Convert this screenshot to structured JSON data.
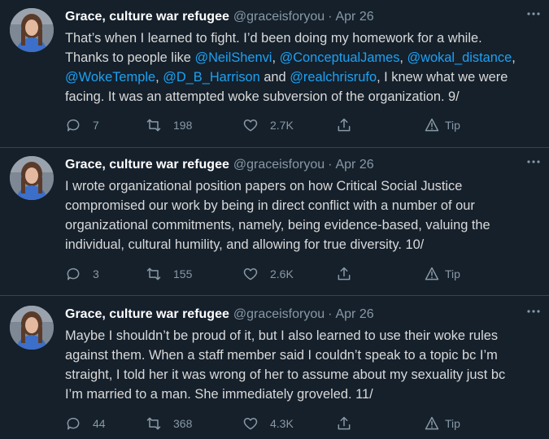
{
  "tweets": [
    {
      "display_name": "Grace, culture war refugee",
      "handle": "@graceisforyou",
      "separator": "·",
      "date": "Apr 26",
      "lines": [
        [
          {
            "t": "That’s when I learned to fight. I’d been doing my homework for a while."
          }
        ],
        [
          {
            "t": "Thanks to people like "
          },
          {
            "t": "@NeilShenvi",
            "m": true
          },
          {
            "t": ", "
          },
          {
            "t": "@ConceptualJames",
            "m": true
          },
          {
            "t": ", "
          },
          {
            "t": "@wokal_distance",
            "m": true
          },
          {
            "t": ","
          }
        ],
        [
          {
            "t": "@WokeTemple",
            "m": true
          },
          {
            "t": ", "
          },
          {
            "t": "@D_B_Harrison",
            "m": true
          },
          {
            "t": " and "
          },
          {
            "t": "@realchrisrufo",
            "m": true
          },
          {
            "t": ", I knew what we were"
          }
        ],
        [
          {
            "t": "facing. It was an attempted woke subversion of the organization. 9/"
          }
        ]
      ],
      "replies": "7",
      "retweets": "198",
      "likes": "2.7K",
      "tip_label": "Tip"
    },
    {
      "display_name": "Grace, culture war refugee",
      "handle": "@graceisforyou",
      "separator": "·",
      "date": "Apr 26",
      "lines": [
        [
          {
            "t": "I wrote organizational position papers on how Critical Social Justice"
          }
        ],
        [
          {
            "t": "compromised our work by being in direct conflict with a number of our"
          }
        ],
        [
          {
            "t": "organizational commitments, namely, being evidence-based, valuing the"
          }
        ],
        [
          {
            "t": "individual, cultural humility, and allowing for true diversity. 10/"
          }
        ]
      ],
      "replies": "3",
      "retweets": "155",
      "likes": "2.6K",
      "tip_label": "Tip"
    },
    {
      "display_name": "Grace, culture war refugee",
      "handle": "@graceisforyou",
      "separator": "·",
      "date": "Apr 26",
      "lines": [
        [
          {
            "t": "Maybe I shouldn’t be proud of it, but I also learned to use their woke rules"
          }
        ],
        [
          {
            "t": "against them. When a staff member said I couldn’t speak to a topic bc I’m"
          }
        ],
        [
          {
            "t": "straight, I told her it was wrong of her to assume about my sexuality just bc"
          }
        ],
        [
          {
            "t": "I’m married to a man. She immediately groveled. 11/"
          }
        ]
      ],
      "replies": "44",
      "retweets": "368",
      "likes": "4.3K",
      "tip_label": "Tip"
    }
  ],
  "icons": {
    "reply": "reply-icon",
    "retweet": "retweet-icon",
    "like": "heart-icon",
    "share": "share-icon",
    "tip": "tip-icon",
    "more": "more-options-icon"
  },
  "colors": {
    "background": "#15202b",
    "text": "#d9d9d9",
    "secondary": "#8899a6",
    "mention": "#1da1f2",
    "divider": "#38444d"
  }
}
